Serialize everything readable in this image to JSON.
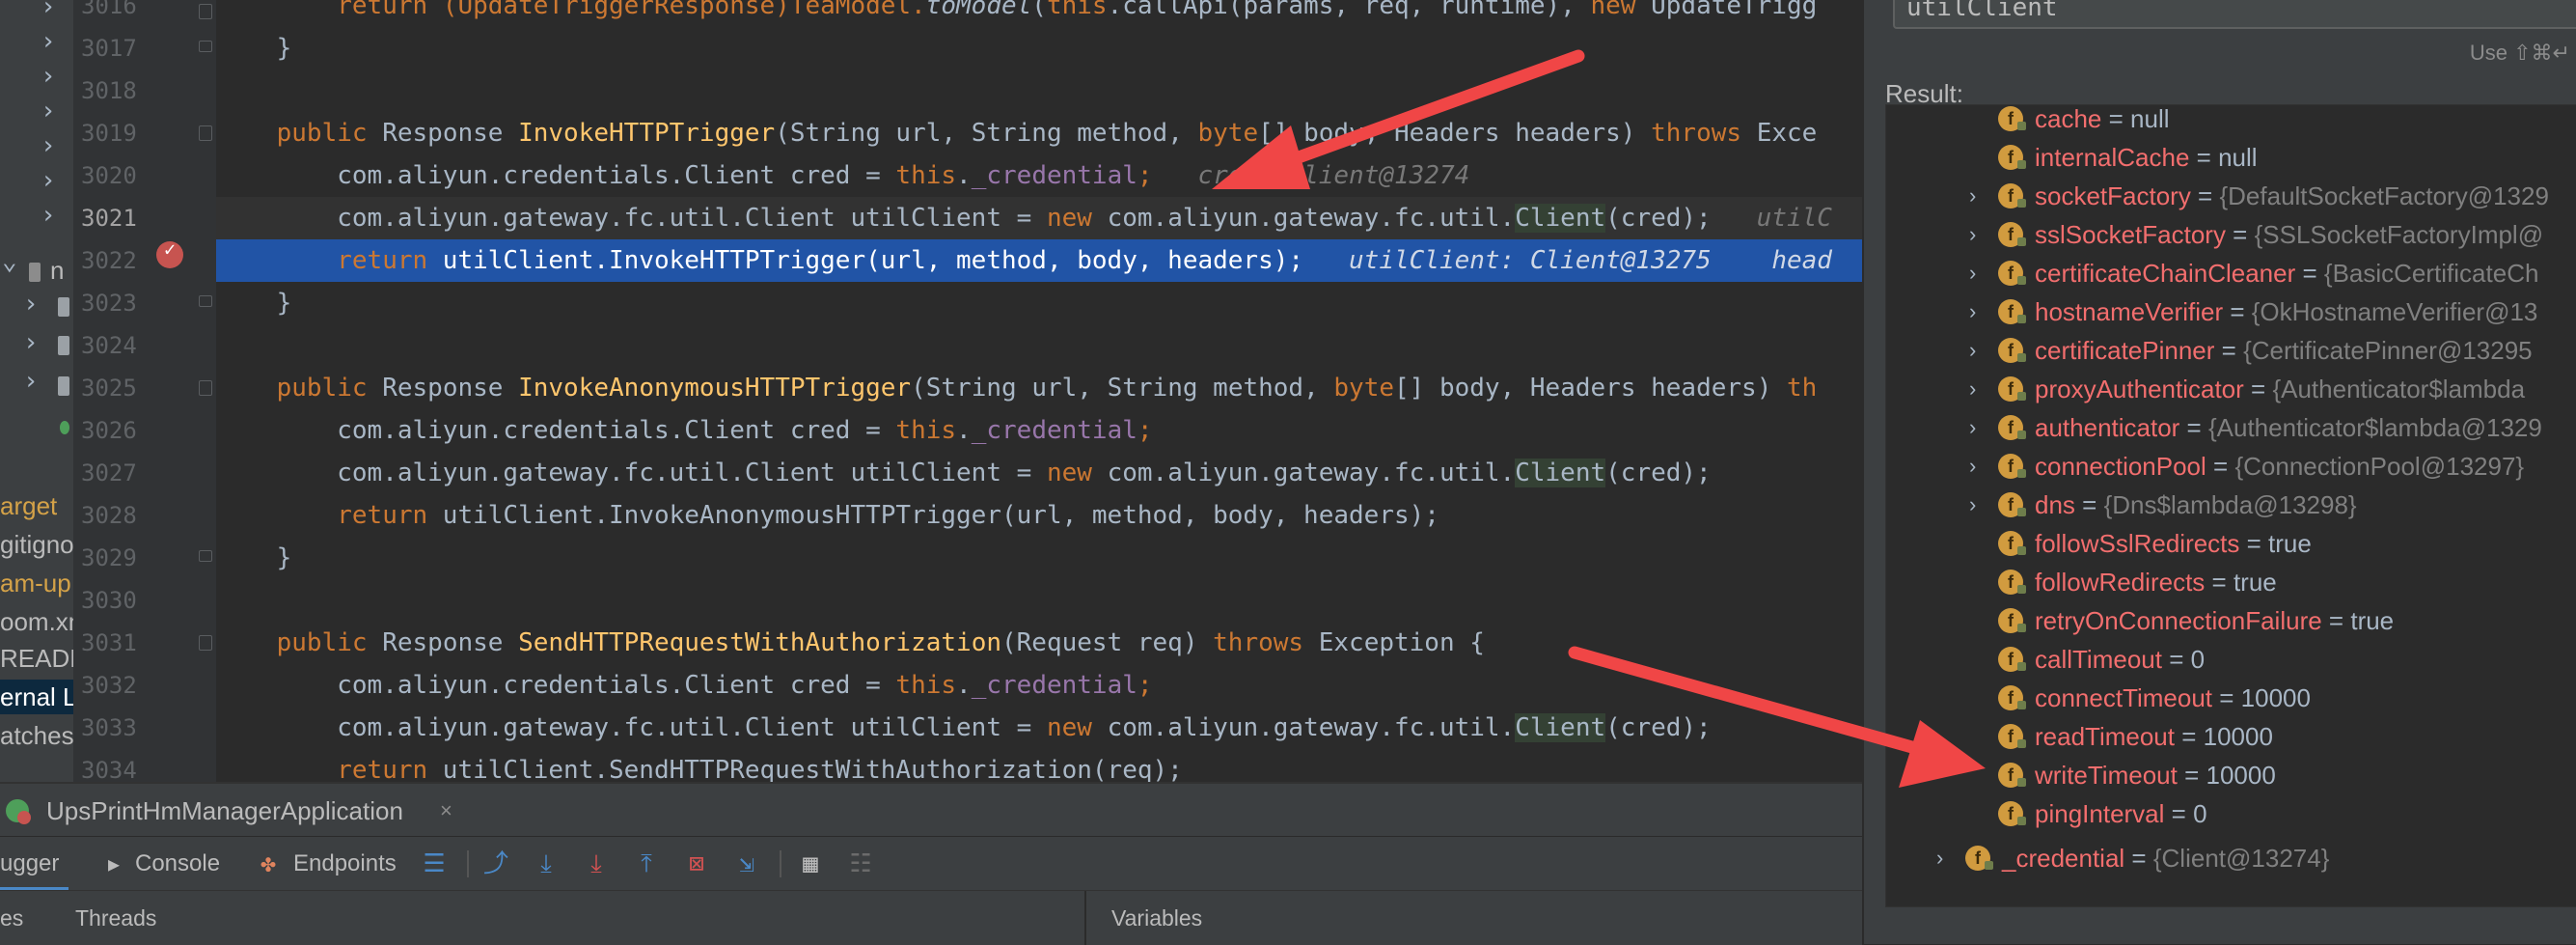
{
  "project_tree": {
    "items": [
      {
        "label": "n"
      },
      {
        "label": "arget"
      },
      {
        "label": "gitigno"
      },
      {
        "label": "am-up"
      },
      {
        "label": "oom.xn"
      },
      {
        "label": "READM"
      },
      {
        "label": "ernal L"
      },
      {
        "label": "atches"
      }
    ]
  },
  "editor": {
    "line_numbers": [
      "3016",
      "3017",
      "3018",
      "3019",
      "3020",
      "3021",
      "3022",
      "3023",
      "3024",
      "3025",
      "3026",
      "3027",
      "3028",
      "3029",
      "3030",
      "3031",
      "3032",
      "3033",
      "3034"
    ],
    "lines": {
      "l3016": {
        "a": "return (UpdateTriggerResponse)TeaModel.",
        "b": "toModel",
        "c": "(",
        "d": "this",
        "e": ".callApi(params, req, runtime), ",
        "f": "new",
        "g": " UpdateTrigg"
      },
      "l3017": {
        "a": "}"
      },
      "l3019": {
        "a": "public",
        "b": " Response ",
        "c": "InvokeHTTPTrigger",
        "d": "(String url, String method, ",
        "e": "byte",
        "f": "[] body, Headers headers) ",
        "g": "throws",
        "h": " Exce"
      },
      "l3020": {
        "a": "com.aliyun.credentials.Client cred = ",
        "b": "this",
        "c": ".",
        "d": "_credential",
        "e": ";",
        "f": "   cred: Client@13274"
      },
      "l3021": {
        "a": "com.aliyun.gateway.fc.util.Client utilClient = ",
        "b": "new",
        "c": " com.aliyun.gateway.fc.util.",
        "d": "Client",
        "e": "(cred);",
        "f": "   utilC"
      },
      "l3022": {
        "a": "return",
        "b": " utilClient.InvokeHTTPTrigger(url, method, body, headers);",
        "c": "   utilClient: Client@13275    head"
      },
      "l3023": {
        "a": "}"
      },
      "l3025": {
        "a": "public",
        "b": " Response ",
        "c": "InvokeAnonymousHTTPTrigger",
        "d": "(String url, String method, ",
        "e": "byte",
        "f": "[] body, Headers headers) ",
        "g": "th"
      },
      "l3026": {
        "a": "com.aliyun.credentials.Client cred = ",
        "b": "this",
        "c": ".",
        "d": "_credential",
        "e": ";"
      },
      "l3027": {
        "a": "com.aliyun.gateway.fc.util.Client utilClient = ",
        "b": "new",
        "c": " com.aliyun.gateway.fc.util.",
        "d": "Client",
        "e": "(cred);"
      },
      "l3028": {
        "a": "return",
        "b": " utilClient.InvokeAnonymousHTTPTrigger(url, method, body, headers);"
      },
      "l3029": {
        "a": "}"
      },
      "l3031": {
        "a": "public",
        "b": " Response ",
        "c": "SendHTTPRequestWithAuthorization",
        "d": "(Request req) ",
        "e": "throws",
        "f": " Exception {"
      },
      "l3032": {
        "a": "com.aliyun.credentials.Client cred = ",
        "b": "this",
        "c": ".",
        "d": "_credential",
        "e": ";"
      },
      "l3033": {
        "a": "com.aliyun.gateway.fc.util.Client utilClient = ",
        "b": "new",
        "c": " com.aliyun.gateway.fc.util.",
        "d": "Client",
        "e": "(cred);"
      },
      "l3034": {
        "a": "return",
        "b": " utilClient.SendHTTPRequestWithAuthorization(req);"
      }
    }
  },
  "evaluate": {
    "expression": "utilClient",
    "hint": "Use ⇧⌘↵",
    "result_label": "Result:",
    "rows": [
      {
        "name": "cache",
        "eq": " = ",
        "value": "null"
      },
      {
        "name": "internalCache",
        "eq": " = ",
        "value": "null"
      },
      {
        "name": "socketFactory",
        "eq": " = ",
        "value": "{DefaultSocketFactory@1329"
      },
      {
        "name": "sslSocketFactory",
        "eq": " = ",
        "value": "{SSLSocketFactoryImpl@"
      },
      {
        "name": "certificateChainCleaner",
        "eq": " = ",
        "value": "{BasicCertificateCh"
      },
      {
        "name": "hostnameVerifier",
        "eq": " = ",
        "value": "{OkHostnameVerifier@13"
      },
      {
        "name": "certificatePinner",
        "eq": " = ",
        "value": "{CertificatePinner@13295"
      },
      {
        "name": "proxyAuthenticator",
        "eq": " = ",
        "value": "{Authenticator$lambda"
      },
      {
        "name": "authenticator",
        "eq": " = ",
        "value": "{Authenticator$lambda@1329"
      },
      {
        "name": "connectionPool",
        "eq": " = ",
        "value": "{ConnectionPool@13297}"
      },
      {
        "name": "dns",
        "eq": " = ",
        "value": "{Dns$lambda@13298}"
      },
      {
        "name": "followSslRedirects",
        "eq": " = ",
        "value": "true"
      },
      {
        "name": "followRedirects",
        "eq": " = ",
        "value": "true"
      },
      {
        "name": "retryOnConnectionFailure",
        "eq": " = ",
        "value": "true"
      },
      {
        "name": "callTimeout",
        "eq": " = ",
        "value": "0"
      },
      {
        "name": "connectTimeout",
        "eq": " = ",
        "value": "10000"
      },
      {
        "name": "readTimeout",
        "eq": " = ",
        "value": "10000"
      },
      {
        "name": "writeTimeout",
        "eq": " = ",
        "value": "10000"
      },
      {
        "name": "pingInterval",
        "eq": " = ",
        "value": "0"
      },
      {
        "name": "_credential",
        "eq": " = ",
        "value": "{Client@13274}"
      }
    ],
    "field_icon_letter": "f"
  },
  "run_bar": {
    "config_name": "UpsPrintHmManagerApplication",
    "close_glyph": "×"
  },
  "tool_bar": {
    "debugger_label": "ugger",
    "console_label": "Console",
    "endpoints_label": "Endpoints"
  },
  "sub_bar": {
    "frames_label": "es",
    "threads_label": "Threads",
    "variables_label": "Variables"
  },
  "colors": {
    "editor_bg": "#2b2b2b",
    "keyword": "#cc7832",
    "method": "#ffc66d",
    "field": "#9876aa",
    "exec_line": "#2154a6",
    "annotation_arrow": "#f04646"
  }
}
